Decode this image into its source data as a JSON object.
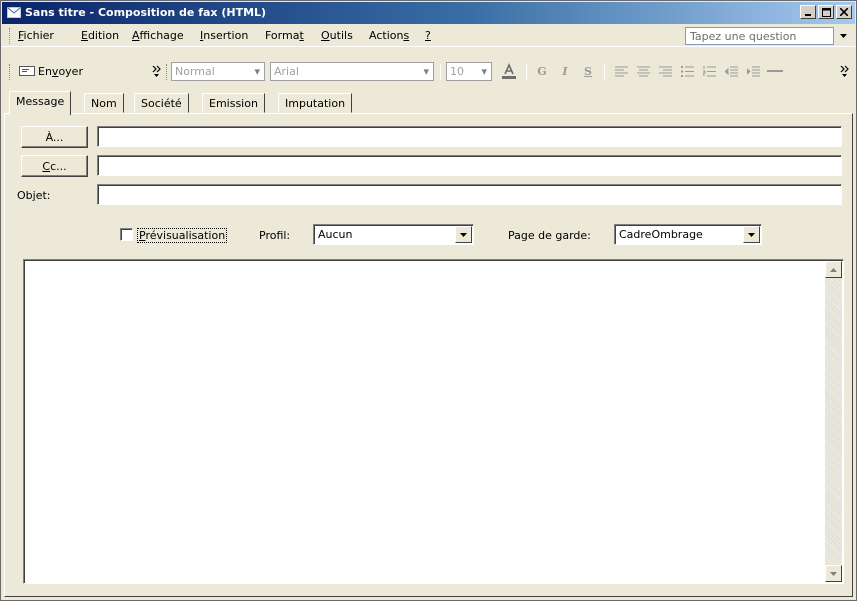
{
  "window": {
    "title": "Sans titre - Composition de fax (HTML)"
  },
  "menu": {
    "items": [
      {
        "pre": "",
        "key": "F",
        "post": "ichier"
      },
      {
        "pre": "",
        "key": "E",
        "post": "dition"
      },
      {
        "pre": "",
        "key": "A",
        "post": "ffichage"
      },
      {
        "pre": "",
        "key": "I",
        "post": "nsertion"
      },
      {
        "pre": "Forma",
        "key": "t",
        "post": ""
      },
      {
        "pre": "",
        "key": "O",
        "post": "utils"
      },
      {
        "pre": "Action",
        "key": "s",
        "post": ""
      },
      {
        "pre": "",
        "key": "?",
        "post": ""
      }
    ],
    "ask_placeholder": "Tapez une question"
  },
  "toolbar": {
    "send_pre": "En",
    "send_key": "v",
    "send_post": "oyer",
    "style_value": "Normal",
    "font_value": "Arial",
    "size_value": "10",
    "bold": "G",
    "italic": "I",
    "underline": "S"
  },
  "tabs": [
    "Message",
    "Nom",
    "Société",
    "Emission",
    "Imputation"
  ],
  "form": {
    "to_label": "À...",
    "cc_key": "C",
    "cc_post": "c...",
    "subject_label_pre": "Ob",
    "subject_label_key": "j",
    "subject_label_post": "et:",
    "to_value": "",
    "cc_value": "",
    "subject_value": ""
  },
  "options": {
    "preview_key": "P",
    "preview_post": "révisualisation",
    "preview_checked": false,
    "profile_label": "Profil:",
    "profile_value": "Aucun",
    "cover_label": "Page de garde:",
    "cover_value": "CadreOmbrage"
  }
}
